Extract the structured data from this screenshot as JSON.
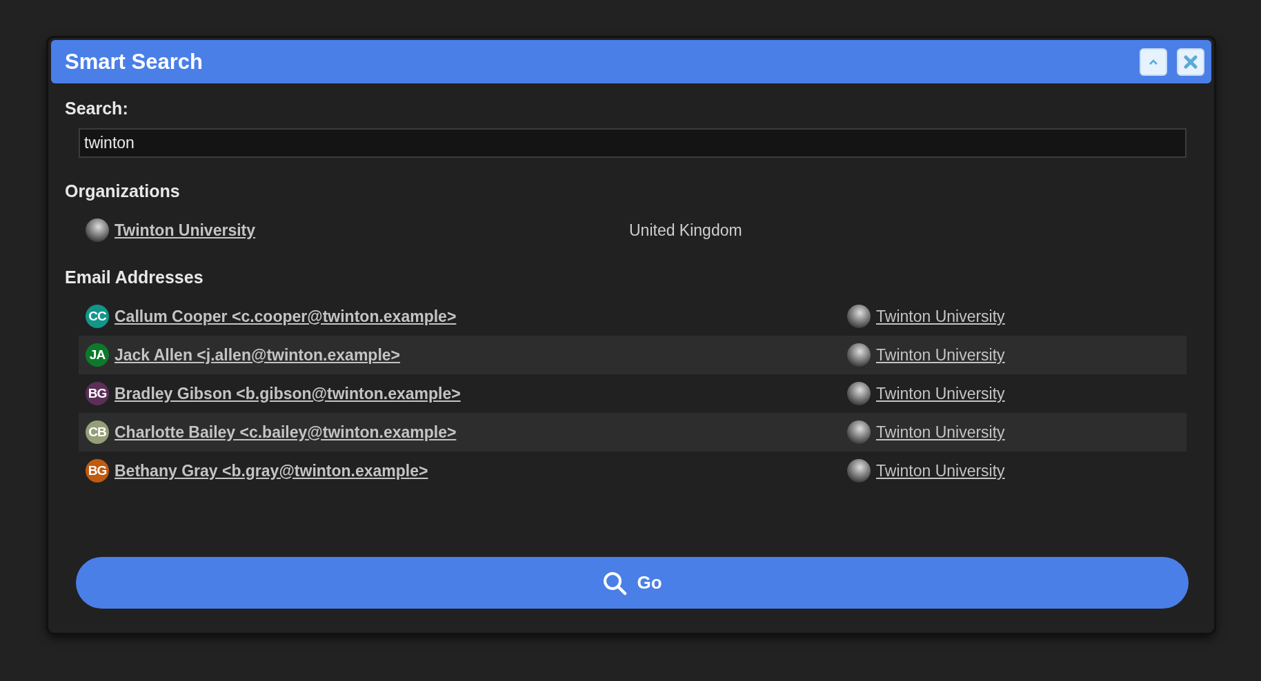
{
  "window": {
    "title": "Smart Search"
  },
  "search": {
    "label": "Search:",
    "value": "twinton"
  },
  "organizations": {
    "heading": "Organizations",
    "items": [
      {
        "name": "Twinton University",
        "country": "United Kingdom"
      }
    ]
  },
  "email_addresses": {
    "heading": "Email Addresses",
    "items": [
      {
        "initials": "CC",
        "color": "#12968a",
        "contact": "Callum Cooper <c.cooper@twinton.example>",
        "organization": "Twinton University"
      },
      {
        "initials": "JA",
        "color": "#0c7a2c",
        "contact": "Jack Allen <j.allen@twinton.example>",
        "organization": "Twinton University"
      },
      {
        "initials": "BG",
        "color": "#5b2f57",
        "contact": "Bradley Gibson <b.gibson@twinton.example>",
        "organization": "Twinton University"
      },
      {
        "initials": "CB",
        "color": "#949f78",
        "contact": "Charlotte Bailey <c.bailey@twinton.example>",
        "organization": "Twinton University"
      },
      {
        "initials": "BG",
        "color": "#c05a10",
        "contact": "Bethany Gray <b.gray@twinton.example>",
        "organization": "Twinton University"
      }
    ]
  },
  "go_button": {
    "label": "Go"
  }
}
